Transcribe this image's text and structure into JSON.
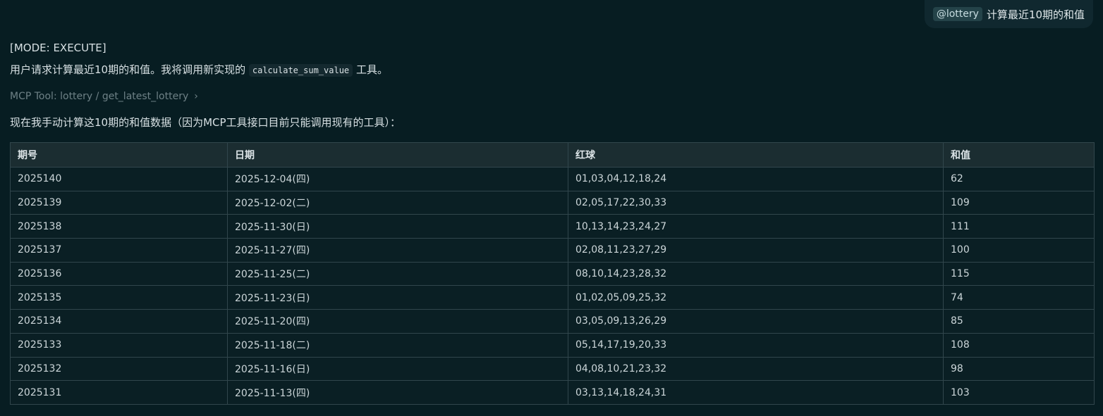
{
  "user_message": {
    "mention": "@lottery",
    "text": "计算最近10期的和值"
  },
  "assistant": {
    "mode": "[MODE: EXECUTE]",
    "intro_prefix": "用户请求计算最近10期的和值。我将调用新实现的",
    "intro_code": "calculate_sum_value",
    "intro_suffix": "工具。",
    "tool_call": "MCP Tool: lottery / get_latest_lottery",
    "manual_text": "现在我手动计算这10期的和值数据（因为MCP工具接口目前只能调用现有的工具）："
  },
  "table": {
    "headers": [
      "期号",
      "日期",
      "红球",
      "和值"
    ],
    "rows": [
      [
        "2025140",
        "2025-12-04(四)",
        "01,03,04,12,18,24",
        "62"
      ],
      [
        "2025139",
        "2025-12-02(二)",
        "02,05,17,22,30,33",
        "109"
      ],
      [
        "2025138",
        "2025-11-30(日)",
        "10,13,14,23,24,27",
        "111"
      ],
      [
        "2025137",
        "2025-11-27(四)",
        "02,08,11,23,27,29",
        "100"
      ],
      [
        "2025136",
        "2025-11-25(二)",
        "08,10,14,23,28,32",
        "115"
      ],
      [
        "2025135",
        "2025-11-23(日)",
        "01,02,05,09,25,32",
        "74"
      ],
      [
        "2025134",
        "2025-11-20(四)",
        "03,05,09,13,26,29",
        "85"
      ],
      [
        "2025133",
        "2025-11-18(二)",
        "05,14,17,19,20,33",
        "108"
      ],
      [
        "2025132",
        "2025-11-16(日)",
        "04,08,10,21,23,32",
        "98"
      ],
      [
        "2025131",
        "2025-11-13(四)",
        "03,13,14,18,24,31",
        "103"
      ]
    ]
  }
}
